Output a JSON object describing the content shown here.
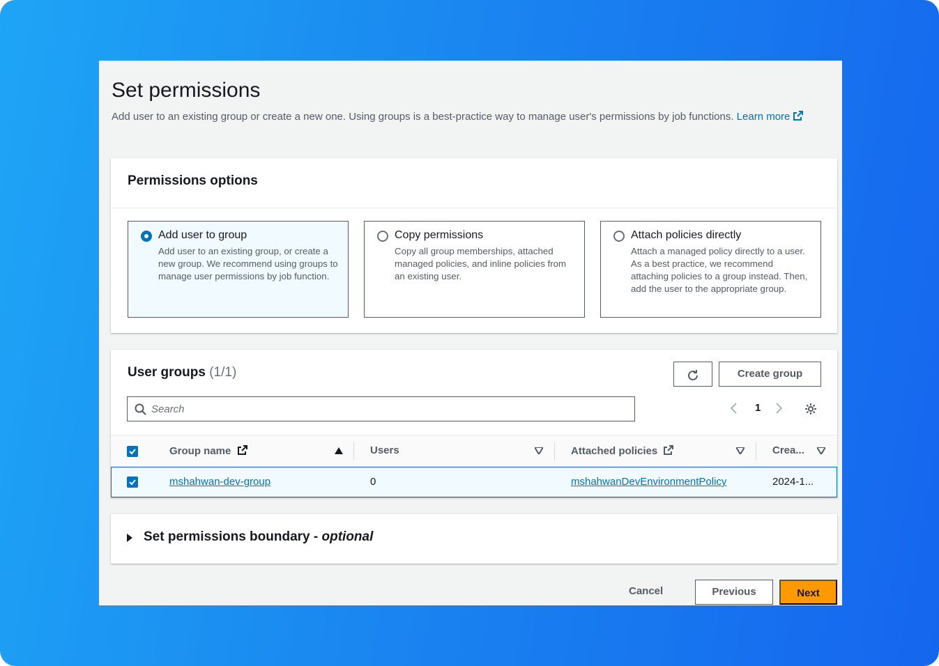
{
  "page": {
    "title": "Set permissions",
    "description": "Add user to an existing group or create a new one. Using groups is a best-practice way to manage user's permissions by job functions.",
    "learn_more": "Learn more"
  },
  "permissions_options": {
    "title": "Permissions options",
    "options": [
      {
        "label": "Add user to group",
        "description": "Add user to an existing group, or create a new group. We recommend using groups to manage user permissions by job function.",
        "selected": true
      },
      {
        "label": "Copy permissions",
        "description": "Copy all group memberships, attached managed policies, and inline policies from an existing user.",
        "selected": false
      },
      {
        "label": "Attach policies directly",
        "description": "Attach a managed policy directly to a user. As a best practice, we recommend attaching policies to a group instead. Then, add the user to the appropriate group.",
        "selected": false
      }
    ]
  },
  "user_groups": {
    "title": "User groups",
    "count": "(1/1)",
    "create_group_label": "Create group",
    "search_placeholder": "Search",
    "page_number": "1",
    "columns": [
      "Group name",
      "Users",
      "Attached policies",
      "Crea..."
    ],
    "rows": [
      {
        "group_name": "mshahwan-dev-group",
        "users": "0",
        "attached_policies": "mshahwanDevEnvironmentPolicy",
        "created": "2024-1...",
        "checked": true
      }
    ]
  },
  "boundary": {
    "title": "Set permissions boundary - ",
    "optional": "optional"
  },
  "footer": {
    "cancel_label": "Cancel",
    "previous_label": "Previous",
    "next_label": "Next"
  },
  "colors": {
    "accent": "#0073bb",
    "primary_button": "#ff9900",
    "background_gradient_start": "#1ea5f6",
    "background_gradient_end": "#1566ee"
  },
  "icons": [
    "external-link-icon",
    "radio-selected-icon",
    "radio-unselected-icon",
    "refresh-icon",
    "search-icon",
    "chevron-left-icon",
    "chevron-right-icon",
    "gear-icon",
    "checkbox-checked-icon",
    "sort-ascending-icon",
    "sort-descending-icon",
    "caret-right-icon"
  ]
}
